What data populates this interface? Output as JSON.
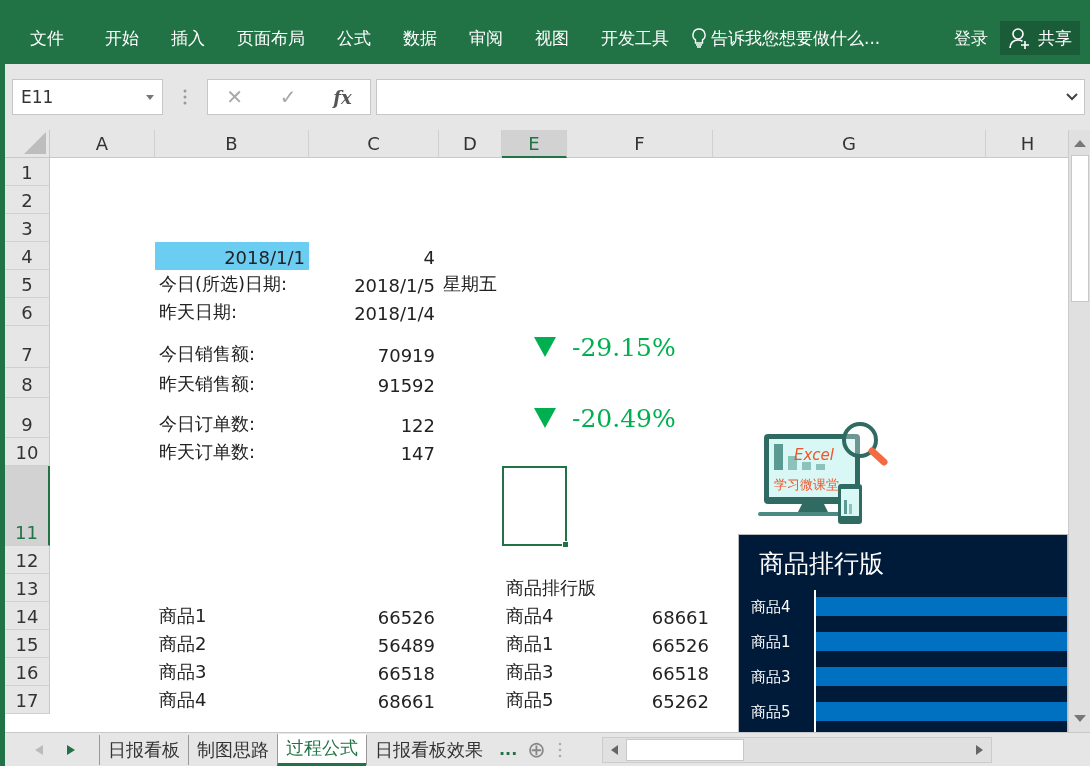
{
  "ribbon": {
    "tabs": [
      {
        "label": "文件",
        "selected": false
      },
      {
        "label": "开始",
        "selected": false
      },
      {
        "label": "插入",
        "selected": false
      },
      {
        "label": "页面布局",
        "selected": false
      },
      {
        "label": "公式",
        "selected": false
      },
      {
        "label": "数据",
        "selected": false
      },
      {
        "label": "审阅",
        "selected": false
      },
      {
        "label": "视图",
        "selected": false
      },
      {
        "label": "开发工具",
        "selected": false
      }
    ],
    "tell_me": "告诉我您想要做什么...",
    "sign_in": "登录",
    "share": "共享"
  },
  "formula_bar": {
    "name_box": "E11",
    "cancel": "✕",
    "enter": "✓",
    "function": "fx"
  },
  "sheet": {
    "columns": [
      {
        "label": "A",
        "selected": false
      },
      {
        "label": "B",
        "selected": false
      },
      {
        "label": "C",
        "selected": false
      },
      {
        "label": "D",
        "selected": false
      },
      {
        "label": "E",
        "selected": true
      },
      {
        "label": "F",
        "selected": false
      },
      {
        "label": "G",
        "selected": false
      },
      {
        "label": "H",
        "selected": false
      }
    ],
    "rows": [
      {
        "label": "1",
        "selected": false
      },
      {
        "label": "2",
        "selected": false
      },
      {
        "label": "3",
        "selected": false
      },
      {
        "label": "4",
        "selected": false,
        "cells": {
          "B": {
            "kind": "number",
            "text": "2018/1/1",
            "color": "#6ccdf3"
          },
          "C": {
            "kind": "number",
            "text": "4"
          }
        }
      },
      {
        "label": "5",
        "selected": false,
        "cells": {
          "B": {
            "kind": "label",
            "text": "今日(所选)日期:"
          },
          "C": {
            "kind": "number",
            "text": "2018/1/5"
          },
          "D": {
            "text": "星期五"
          }
        }
      },
      {
        "label": "6",
        "selected": false,
        "cells": {
          "B": {
            "kind": "label",
            "text": "昨天日期:"
          },
          "C": {
            "kind": "number",
            "text": "2018/1/4"
          }
        }
      },
      {
        "label": "7",
        "selected": false,
        "cells": {
          "B": {
            "kind": "label",
            "text": "今日销售额:"
          },
          "C": {
            "kind": "number",
            "text": "70919"
          },
          "E": {
            "kind": "indicator",
            "down": true,
            "text": "-29.15%"
          }
        }
      },
      {
        "label": "8",
        "selected": false,
        "cells": {
          "B": {
            "kind": "label",
            "text": "昨天销售额:"
          },
          "C": {
            "kind": "number",
            "text": "91592"
          }
        }
      },
      {
        "label": "9",
        "selected": false,
        "cells": {
          "B": {
            "kind": "label",
            "text": "今日订单数:"
          },
          "C": {
            "kind": "number",
            "text": "122"
          },
          "E": {
            "kind": "indicator",
            "down": true,
            "text": "-20.49%"
          }
        }
      },
      {
        "label": "10",
        "selected": false,
        "cells": {
          "B": {
            "kind": "label",
            "text": "昨天订单数:"
          },
          "C": {
            "kind": "number",
            "text": "147"
          }
        }
      },
      {
        "label": "11",
        "selected": true
      },
      {
        "label": "12",
        "selected": false
      },
      {
        "label": "13",
        "selected": false,
        "cells": {
          "E": {
            "kind": "label",
            "text": "商品排行版"
          }
        }
      },
      {
        "label": "14",
        "selected": false,
        "cells": {
          "B": {
            "kind": "label",
            "text": "商品1"
          },
          "C": {
            "kind": "number",
            "text": "66526"
          },
          "E": {
            "kind": "label",
            "text": "商品4"
          },
          "F": {
            "kind": "number",
            "text": "68661"
          }
        }
      },
      {
        "label": "15",
        "selected": false,
        "cells": {
          "B": {
            "kind": "label",
            "text": "商品2"
          },
          "C": {
            "kind": "number",
            "text": "56489"
          },
          "E": {
            "kind": "label",
            "text": "商品1"
          },
          "F": {
            "kind": "number",
            "text": "66526"
          }
        }
      },
      {
        "label": "16",
        "selected": false,
        "cells": {
          "B": {
            "kind": "label",
            "text": "商品3"
          },
          "C": {
            "kind": "number",
            "text": "66518"
          },
          "E": {
            "kind": "label",
            "text": "商品3"
          },
          "F": {
            "kind": "number",
            "text": "66518"
          }
        }
      },
      {
        "label": "17",
        "selected": false,
        "cells": {
          "B": {
            "kind": "label",
            "text": "商品4"
          },
          "C": {
            "kind": "number",
            "text": "68661"
          },
          "E": {
            "kind": "label",
            "text": "商品5"
          },
          "F": {
            "kind": "number",
            "text": "65262"
          }
        }
      }
    ],
    "logo": {
      "title": "Excel",
      "subtitle": "学习微课堂"
    }
  },
  "chart": {
    "title": "商品排行版",
    "bars": [
      {
        "label": "商品4"
      },
      {
        "label": "商品1"
      },
      {
        "label": "商品3"
      },
      {
        "label": "商品5"
      }
    ]
  },
  "sheet_tabs": {
    "tabs": [
      {
        "label": "日报看板",
        "selected": false
      },
      {
        "label": "制图思路",
        "selected": false
      },
      {
        "label": "过程公式",
        "selected": true
      },
      {
        "label": "日报看板效果",
        "selected": false
      }
    ],
    "more": "...",
    "add": "⊕"
  }
}
